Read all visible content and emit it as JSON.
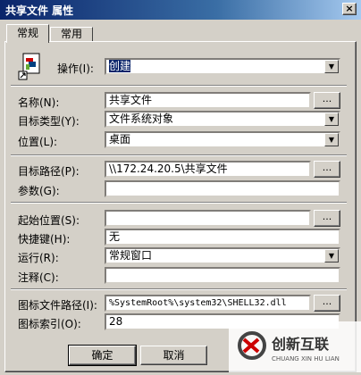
{
  "window": {
    "title": "共享文件 属性",
    "close_label": "×"
  },
  "tabs": [
    {
      "label": "常规"
    },
    {
      "label": "常用"
    }
  ],
  "operation": {
    "label": "操作(I):",
    "value": "创建"
  },
  "fields": {
    "name": {
      "label": "名称(N):",
      "value": "共享文件",
      "button": "..."
    },
    "target_type": {
      "label": "目标类型(Y):",
      "value": "文件系统对象"
    },
    "location": {
      "label": "位置(L):",
      "value": "桌面"
    },
    "target_path": {
      "label": "目标路径(P):",
      "value": "\\\\172.24.20.5\\共享文件",
      "button": "..."
    },
    "arguments": {
      "label": "参数(G):",
      "value": ""
    },
    "start_in": {
      "label": "起始位置(S):",
      "value": "",
      "button": "..."
    },
    "shortcut_key": {
      "label": "快捷键(H):",
      "value": "无"
    },
    "run": {
      "label": "运行(R):",
      "value": "常规窗口"
    },
    "comment": {
      "label": "注释(C):",
      "value": ""
    },
    "icon_path": {
      "label": "图标文件路径(I):",
      "value": "%SystemRoot%\\system32\\SHELL32.dll",
      "button": "..."
    },
    "icon_index": {
      "label": "图标索引(O):",
      "value": "28"
    }
  },
  "buttons": {
    "ok": "确定",
    "cancel": "取消"
  },
  "watermark": {
    "brand": "创新互联",
    "sub": "CHUANG XIN HU LIAN"
  },
  "colors": {
    "titlebar": "#0a246a",
    "face": "#d4d0c8",
    "selection": "#0a246a"
  }
}
